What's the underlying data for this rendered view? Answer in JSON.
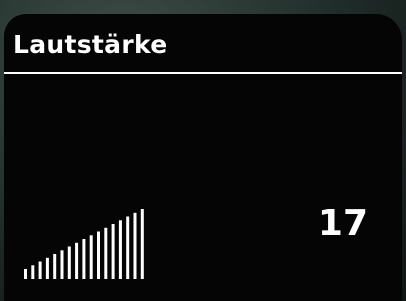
{
  "header": {
    "title": "Lautstärke"
  },
  "volume": {
    "value": "17",
    "level": 17,
    "segments": 17
  },
  "colors": {
    "background": "#050505",
    "foreground": "#ffffff"
  }
}
